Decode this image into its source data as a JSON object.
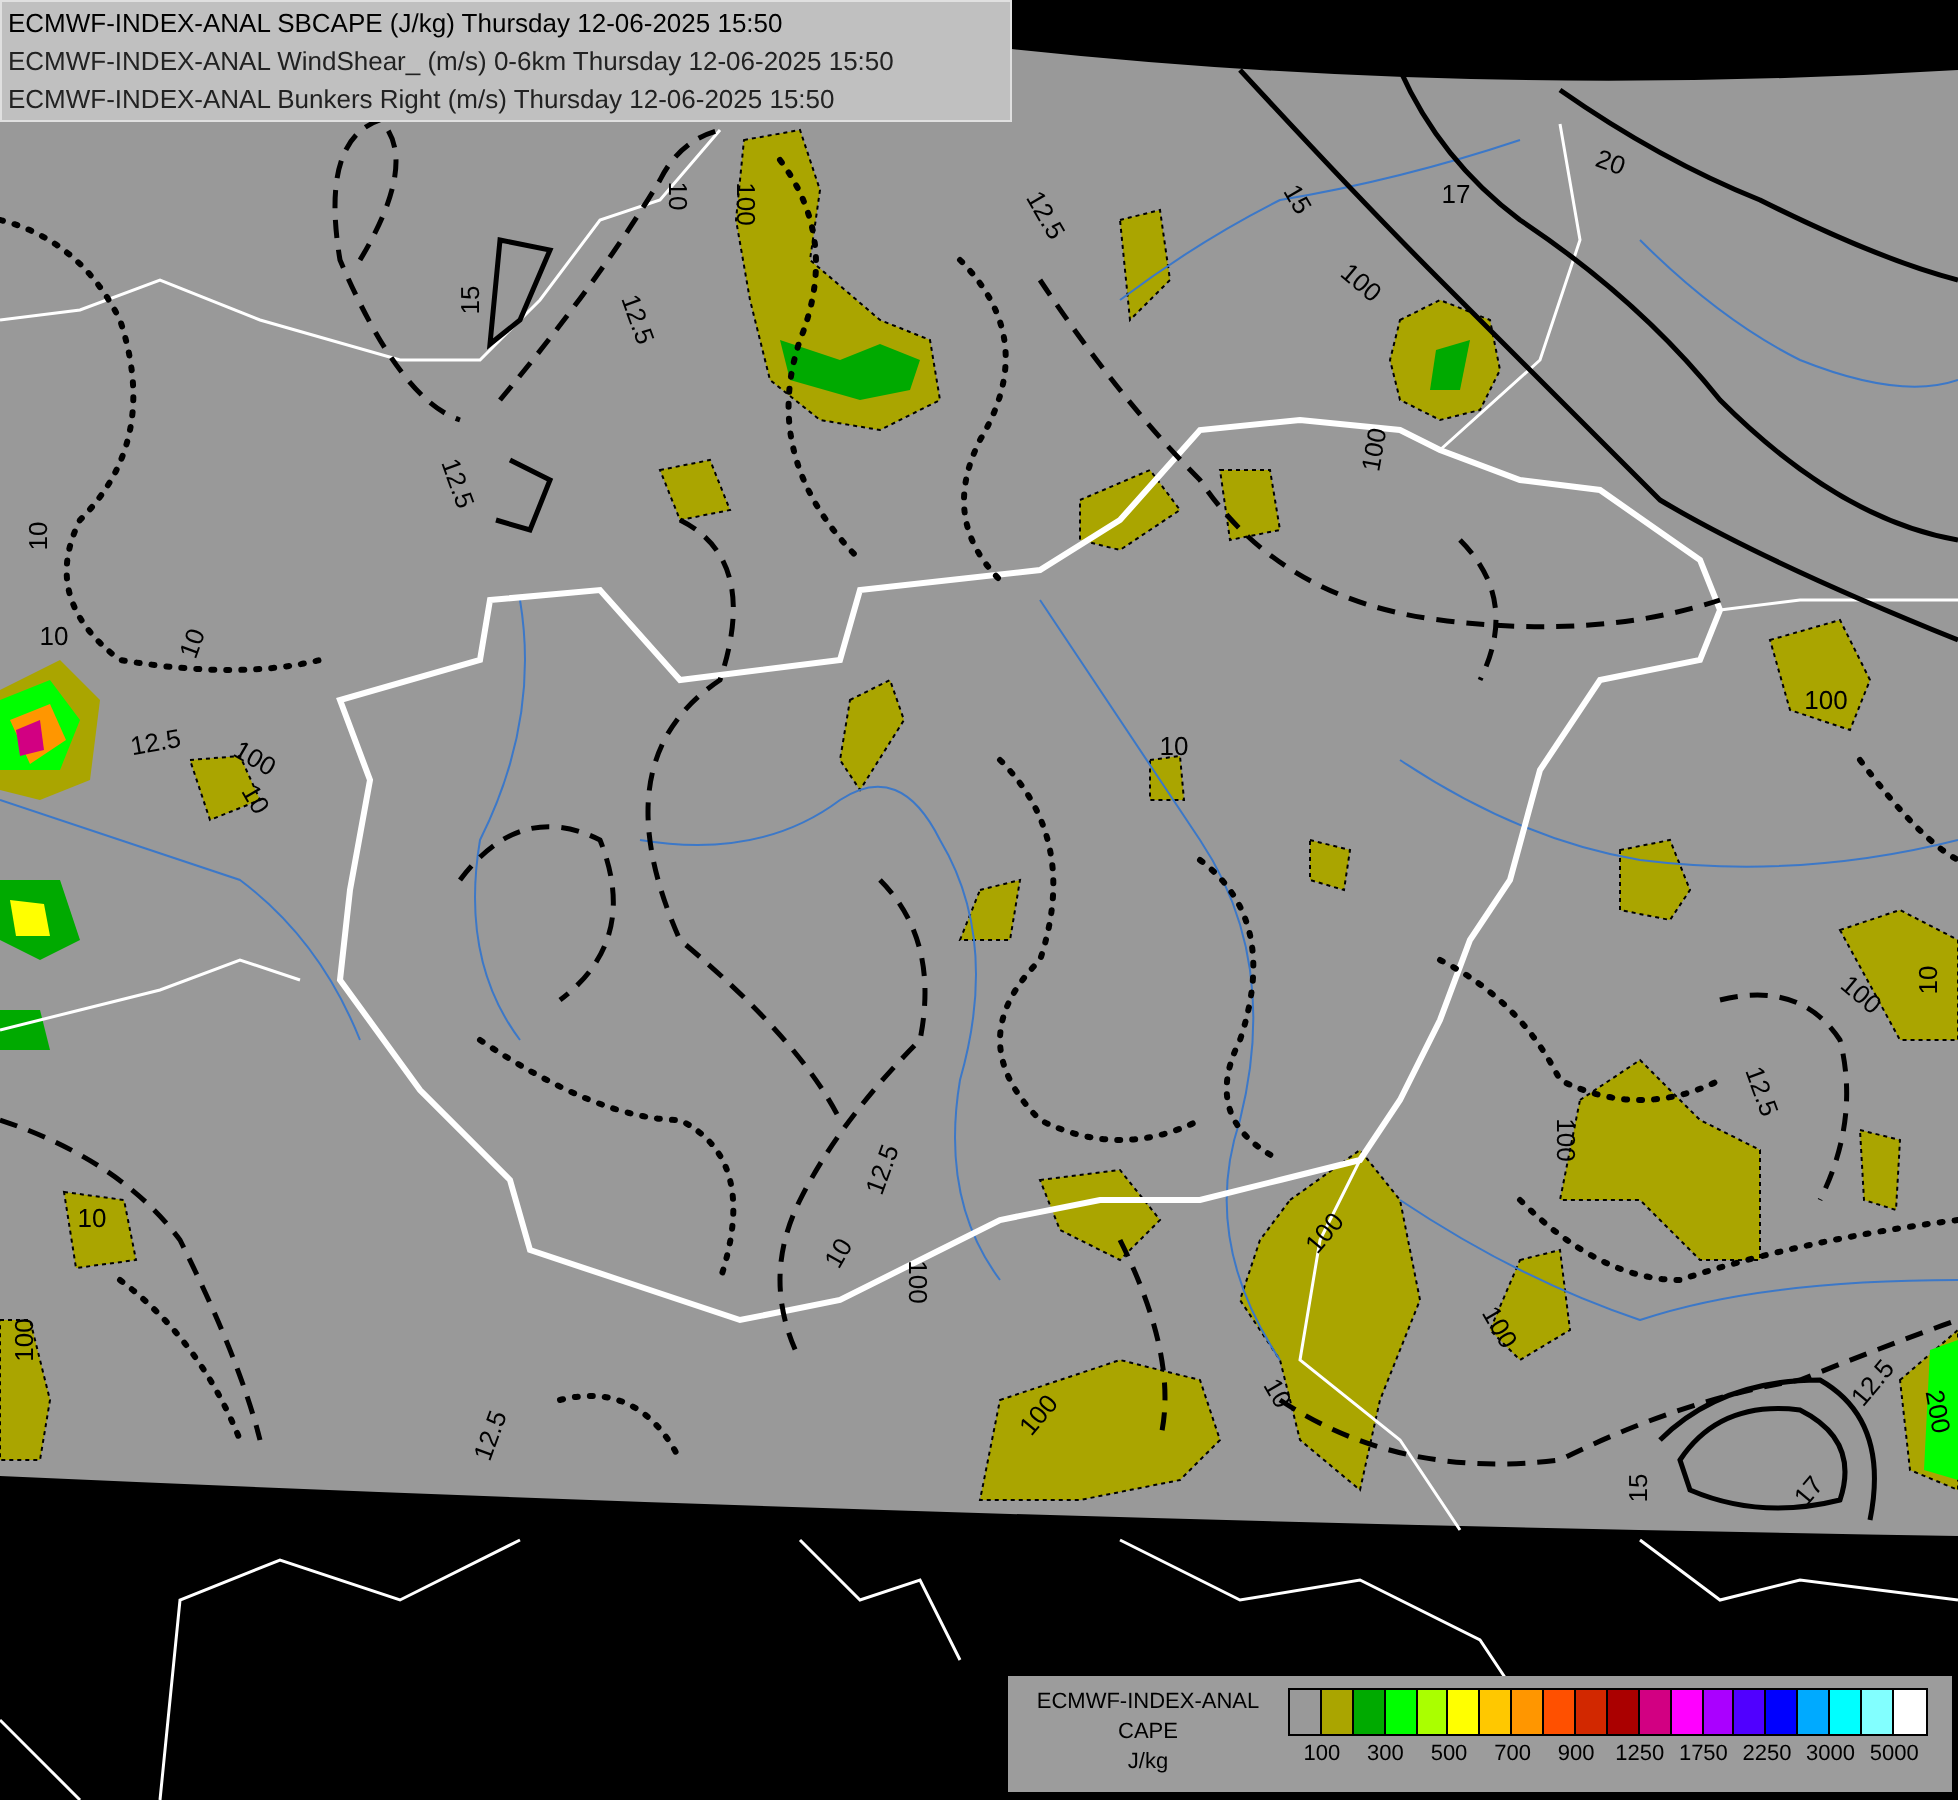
{
  "header": {
    "lines": [
      "ECMWF-INDEX-ANAL SBCAPE (J/kg) Thursday 12-06-2025 15:50",
      "ECMWF-INDEX-ANAL WindShear_ (m/s) 0-6km Thursday 12-06-2025 15:50",
      "ECMWF-INDEX-ANAL Bunkers Right (m/s) Thursday 12-06-2025 15:50"
    ]
  },
  "contour_labels": [
    {
      "text": "10"
    },
    {
      "text": "100"
    },
    {
      "text": "15"
    },
    {
      "text": "12.5"
    },
    {
      "text": "12.5"
    },
    {
      "text": "10"
    },
    {
      "text": "10"
    },
    {
      "text": "10"
    },
    {
      "text": "12.5"
    },
    {
      "text": "100"
    },
    {
      "text": "10"
    },
    {
      "text": "12.5"
    },
    {
      "text": "15"
    },
    {
      "text": "17"
    },
    {
      "text": "20"
    },
    {
      "text": "100"
    },
    {
      "text": "100"
    },
    {
      "text": "10"
    },
    {
      "text": "100"
    },
    {
      "text": "12.5"
    },
    {
      "text": "10"
    },
    {
      "text": "100"
    },
    {
      "text": "10"
    },
    {
      "text": "100"
    },
    {
      "text": "12.5"
    },
    {
      "text": "100"
    },
    {
      "text": "100"
    },
    {
      "text": "10"
    },
    {
      "text": "100"
    },
    {
      "text": "100"
    },
    {
      "text": "12.5"
    },
    {
      "text": "100"
    },
    {
      "text": "10"
    },
    {
      "text": "12.5"
    },
    {
      "text": "15"
    },
    {
      "text": "17"
    },
    {
      "text": "200"
    }
  ],
  "legend": {
    "title_lines": [
      "ECMWF-INDEX-ANAL",
      "CAPE",
      "J/kg"
    ],
    "swatches": [
      {
        "color": "#999999"
      },
      {
        "color": "#aaa500"
      },
      {
        "color": "#00aa00"
      },
      {
        "color": "#00ff00"
      },
      {
        "color": "#aaff00"
      },
      {
        "color": "#ffff00"
      },
      {
        "color": "#ffc800"
      },
      {
        "color": "#ff9600"
      },
      {
        "color": "#ff5000"
      },
      {
        "color": "#d22800"
      },
      {
        "color": "#aa0000"
      },
      {
        "color": "#d20082"
      },
      {
        "color": "#ff00ff"
      },
      {
        "color": "#aa00ff"
      },
      {
        "color": "#5000ff"
      },
      {
        "color": "#0000ff"
      },
      {
        "color": "#00aaff"
      },
      {
        "color": "#00ffff"
      },
      {
        "color": "#82ffff"
      },
      {
        "color": "#ffffff"
      }
    ],
    "ticks": [
      "100",
      "300",
      "500",
      "700",
      "900",
      "1250",
      "1750",
      "2250",
      "3000",
      "5000"
    ]
  }
}
